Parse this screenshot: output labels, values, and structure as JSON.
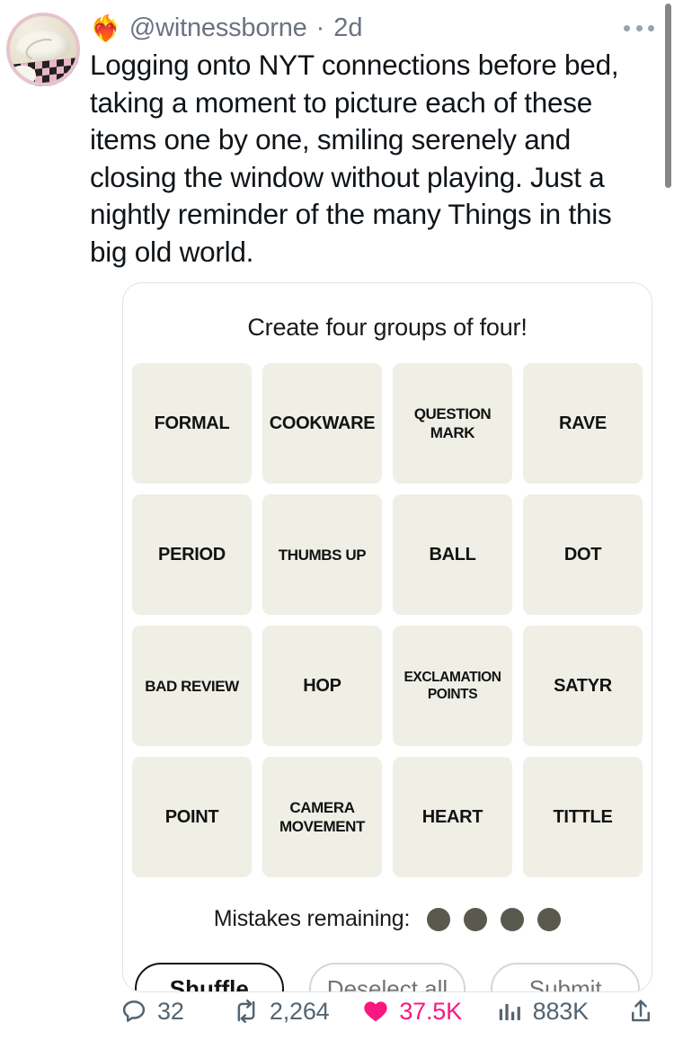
{
  "post": {
    "emoji": "❤️‍🔥",
    "handle": "@witnessborne",
    "separator": "·",
    "timestamp": "2d",
    "more_label": "More",
    "text": "Logging onto NYT connections before bed, taking a moment to picture each of these items one by one, smiling serenely and closing the window without playing. Just a nightly reminder of the many Things in this big old world."
  },
  "game": {
    "title": "Create four groups of four!",
    "tiles": [
      "FORMAL",
      "COOKWARE",
      "QUESTION MARK",
      "RAVE",
      "PERIOD",
      "THUMBS UP",
      "BALL",
      "DOT",
      "BAD REVIEW",
      "HOP",
      "EXCLAMATION POINTS",
      "SATYR",
      "POINT",
      "CAMERA MOVEMENT",
      "HEART",
      "TITTLE"
    ],
    "mistakes_label": "Mistakes remaining:",
    "mistakes_remaining": 4,
    "buttons": {
      "shuffle": "Shuffle",
      "deselect": "Deselect all",
      "submit": "Submit"
    },
    "colors": {
      "tile_bg": "#EFEFE6",
      "mistake_dot": "#5A594E"
    }
  },
  "engagement": {
    "replies": "32",
    "reposts": "2,264",
    "likes": "37.5K",
    "views": "883K",
    "like_color": "#F91880",
    "text_color": "#536471"
  }
}
